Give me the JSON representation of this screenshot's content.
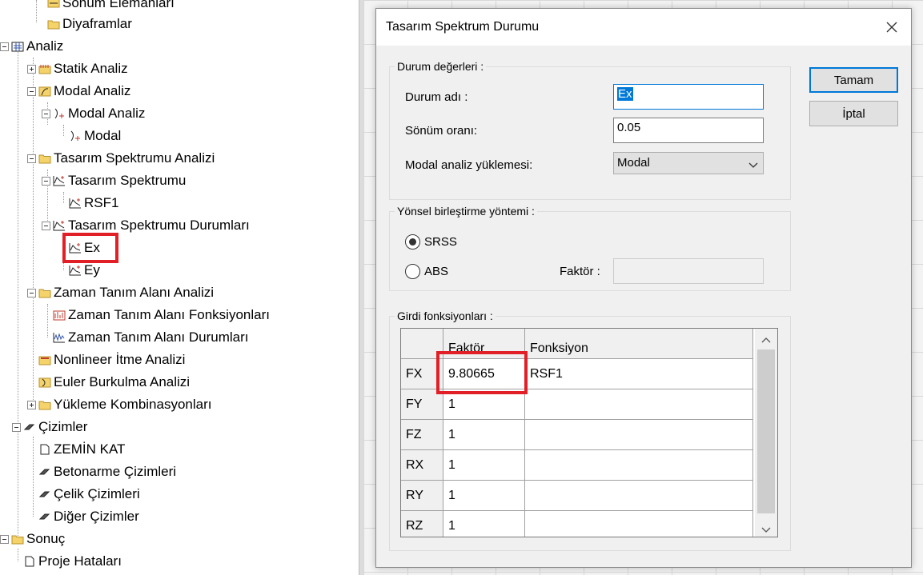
{
  "tree": {
    "items": [
      {
        "label": "Sönüm Elemanları",
        "icon": "damper-icon"
      },
      {
        "label": "Diyaframlar",
        "icon": "folder-icon"
      },
      {
        "label": "Analiz",
        "icon": "analysis-icon"
      },
      {
        "label": "Statik Analiz",
        "icon": "static-icon"
      },
      {
        "label": "Modal Analiz",
        "icon": "modal-icon"
      },
      {
        "label": "Modal Analiz",
        "icon": "modal-shape-icon"
      },
      {
        "label": "Modal",
        "icon": "modal-shape-icon"
      },
      {
        "label": "Tasarım Spektrumu Analizi",
        "icon": "folder-icon"
      },
      {
        "label": "Tasarım Spektrumu",
        "icon": "spectrum-icon"
      },
      {
        "label": "RSF1",
        "icon": "spectrum-icon"
      },
      {
        "label": "Tasarım Spektrumu Durumları",
        "icon": "spectrum-icon"
      },
      {
        "label": "Ex",
        "icon": "spectrum-case-icon"
      },
      {
        "label": "Ey",
        "icon": "spectrum-case-icon"
      },
      {
        "label": "Zaman Tanım Alanı Analizi",
        "icon": "folder-icon"
      },
      {
        "label": "Zaman Tanım Alanı Fonksiyonları",
        "icon": "time-function-icon"
      },
      {
        "label": "Zaman Tanım Alanı Durumları",
        "icon": "time-case-icon"
      },
      {
        "label": "Nonlineer İtme Analizi",
        "icon": "pushover-icon"
      },
      {
        "label": "Euler Burkulma Analizi",
        "icon": "buckling-icon"
      },
      {
        "label": "Yükleme Kombinasyonları",
        "icon": "folder-icon"
      },
      {
        "label": "Çizimler",
        "icon": "drawing-icon"
      },
      {
        "label": "ZEMİN KAT",
        "icon": "page-icon"
      },
      {
        "label": "Betonarme Çizimleri",
        "icon": "drawing-icon"
      },
      {
        "label": "Çelik Çizimleri",
        "icon": "drawing-icon"
      },
      {
        "label": "Diğer Çizimler",
        "icon": "drawing-icon"
      },
      {
        "label": "Sonuç",
        "icon": "folder-icon"
      },
      {
        "label": "Proje Hataları",
        "icon": "page-icon"
      }
    ]
  },
  "dialog": {
    "title": "Tasarım Spektrum Durumu",
    "ok_label": "Tamam",
    "cancel_label": "İptal",
    "case_values": {
      "group_label": "Durum değerleri :",
      "name_label": "Durum adı :",
      "name_value": "Ex",
      "damping_label": "Sönüm oranı:",
      "damping_value": "0.05",
      "modal_label": "Modal analiz yüklemesi:",
      "modal_value": "Modal"
    },
    "combination": {
      "group_label": "Yönsel birleştirme yöntemi :",
      "options": [
        "SRSS",
        "ABS"
      ],
      "selected": "SRSS",
      "factor_label": "Faktör :",
      "factor_value": ""
    },
    "input_functions": {
      "group_label": "Girdi fonksiyonları :",
      "columns": [
        "Faktör",
        "Fonksiyon"
      ],
      "rows": [
        {
          "dir": "FX",
          "factor": "9.80665",
          "function": "RSF1"
        },
        {
          "dir": "FY",
          "factor": "1",
          "function": ""
        },
        {
          "dir": "FZ",
          "factor": "1",
          "function": ""
        },
        {
          "dir": "RX",
          "factor": "1",
          "function": ""
        },
        {
          "dir": "RY",
          "factor": "1",
          "function": ""
        },
        {
          "dir": "RZ",
          "factor": "1",
          "function": ""
        }
      ]
    }
  },
  "colors": {
    "accent": "#0078d7",
    "highlight": "#e11f26"
  }
}
